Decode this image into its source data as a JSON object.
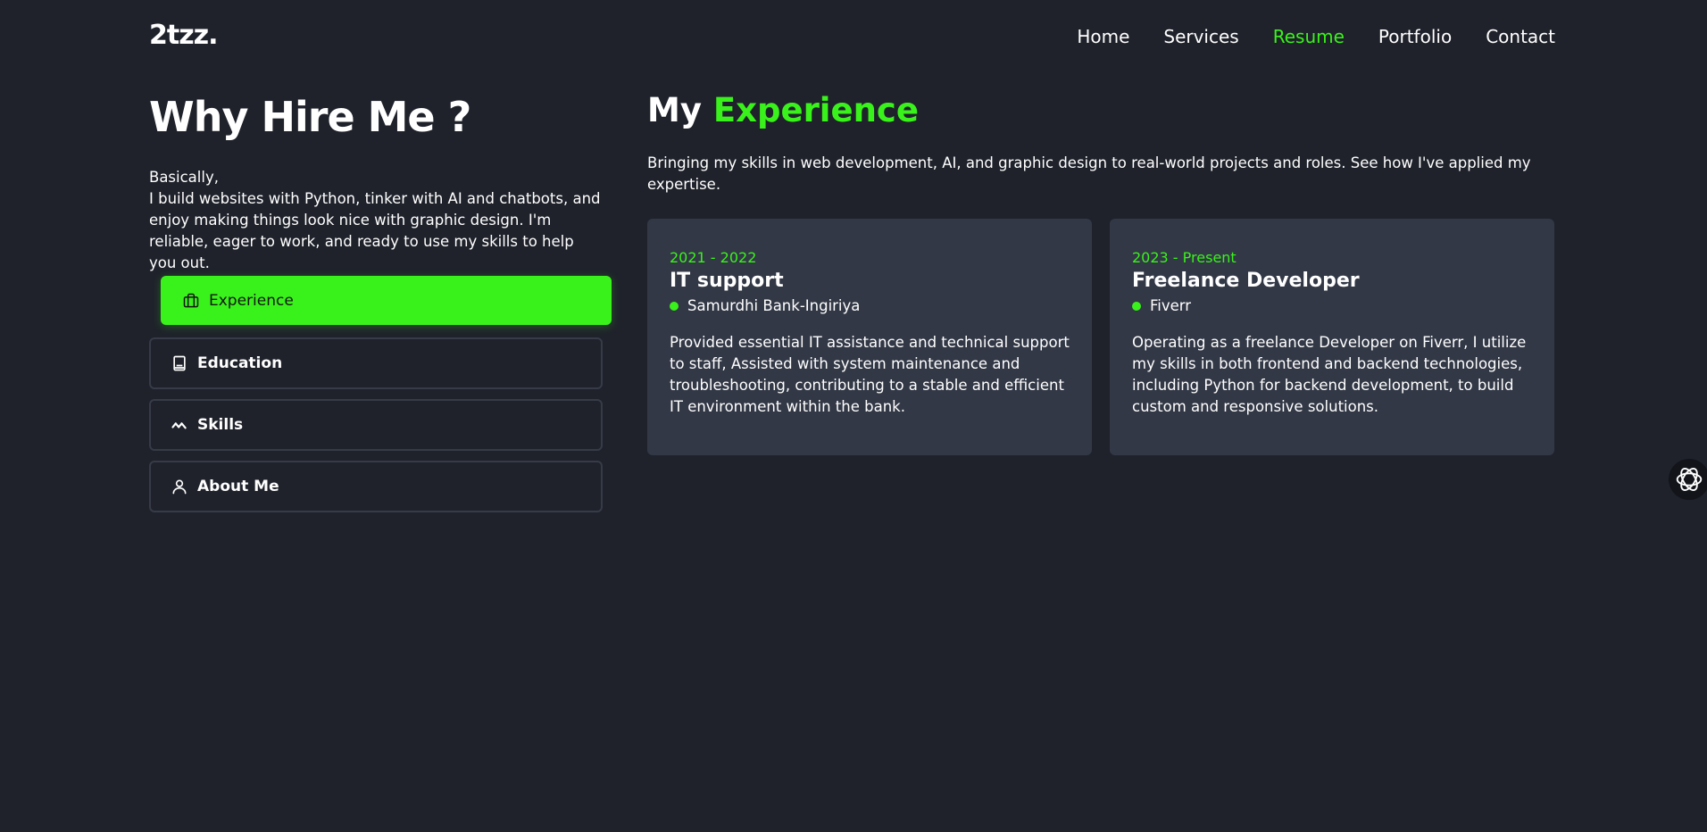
{
  "header": {
    "logo": "2tzz.",
    "nav": [
      {
        "label": "Home"
      },
      {
        "label": "Services"
      },
      {
        "label": "Resume",
        "active": true
      },
      {
        "label": "Portfolio"
      },
      {
        "label": "Contact"
      }
    ]
  },
  "left": {
    "title": "Why Hire Me ?",
    "intro_line1": "Basically,",
    "intro_line2": "I build websites with Python, tinker with AI and chatbots, and enjoy making things look nice with graphic design. I'm reliable, eager to work, and ready to use my skills to help you out.",
    "tabs": [
      {
        "label": "Experience",
        "icon": "briefcase-icon",
        "active": true
      },
      {
        "label": "Education",
        "icon": "book-icon"
      },
      {
        "label": "Skills",
        "icon": "wave-icon"
      },
      {
        "label": "About Me",
        "icon": "user-icon"
      }
    ]
  },
  "experience": {
    "title_prefix": "My",
    "title_accent": "Experience",
    "description": "Bringing my skills in web development, AI, and graphic design to real-world projects and roles. See how I've applied my expertise.",
    "cards": [
      {
        "period": "2021 - 2022",
        "role": "IT support",
        "org": "Samurdhi Bank-Ingiriya",
        "text": "Provided essential IT assistance and technical support to staff, Assisted with system maintenance and troubleshooting, contributing to a stable and efficient IT environment within the bank."
      },
      {
        "period": "2023 - Present",
        "role": "Freelance Developer",
        "org": "Fiverr",
        "text": "Operating as a freelance Developer on Fiverr, I utilize my skills in both frontend and backend technologies, including Python for backend development, to build custom and responsive solutions."
      }
    ]
  },
  "floating_widget": {
    "icon": "chat-widget-icon"
  },
  "colors": {
    "accent": "#3af21b",
    "background": "#1f222b",
    "card": "#323846",
    "border": "#363b47"
  }
}
